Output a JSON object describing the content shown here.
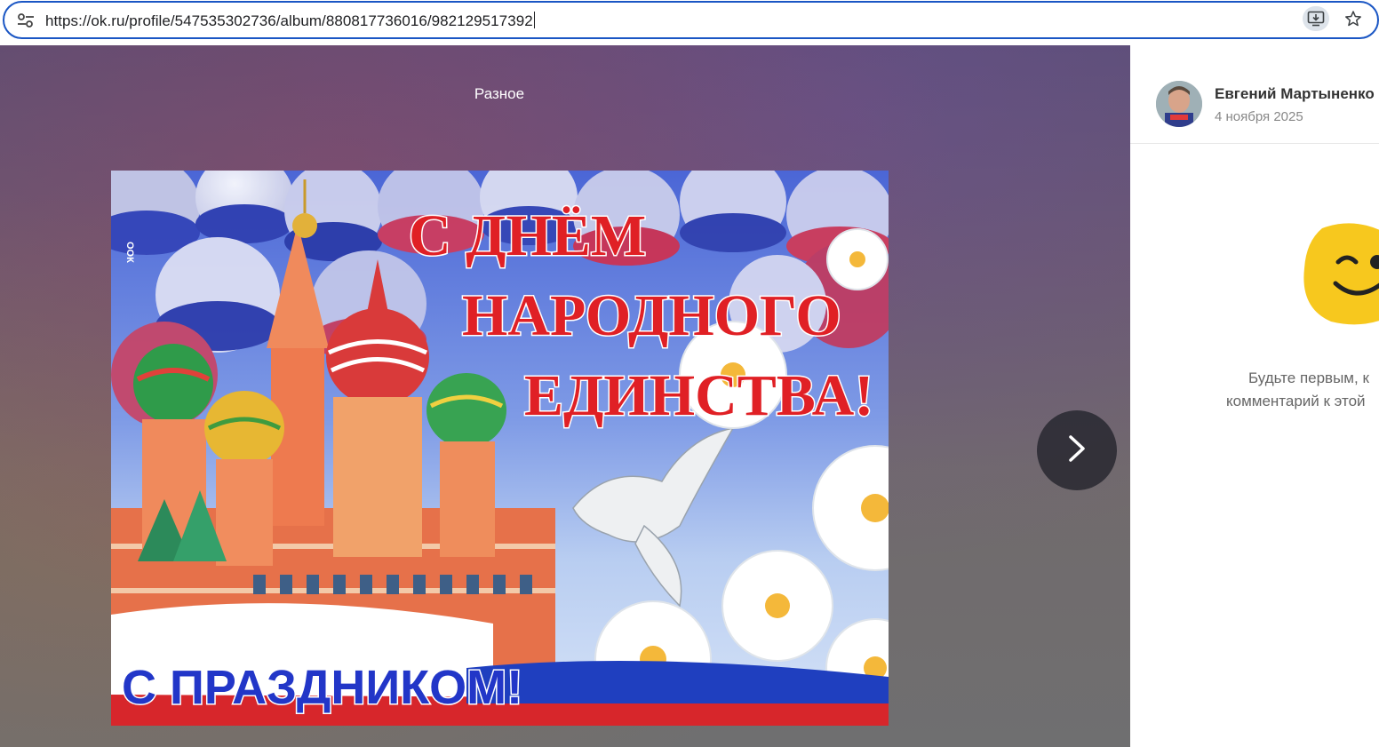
{
  "browser": {
    "url": "https://ok.ru/profile/547535302736/album/880817736016/982129517392",
    "site_info_icon": "tune-icon",
    "install_icon": "install-app-icon",
    "bookmark_icon": "star-icon"
  },
  "viewer": {
    "album_title": "Разное",
    "next_icon": "chevron-right-icon",
    "photo": {
      "watermark": "ООК",
      "headline_line1": "С ДНЁМ",
      "headline_line2": "НАРОДНОГО",
      "headline_line3": "ЕДИНСТВА!",
      "banner_text": "С ПРАЗДНИКОМ!"
    }
  },
  "panel": {
    "author_name": "Евгений Мартыненко",
    "post_date": "4 ноября 2025",
    "empty_comments_line1": "Будьте первым, к",
    "empty_comments_line2": "комментарий к этой"
  },
  "colors": {
    "omnibox_border": "#1a56c4",
    "next_button": "#2e2e36",
    "flag_white": "#ffffff",
    "flag_blue": "#1f3fbf",
    "flag_red": "#d7262b",
    "mascot_yellow": "#f7c81e"
  }
}
